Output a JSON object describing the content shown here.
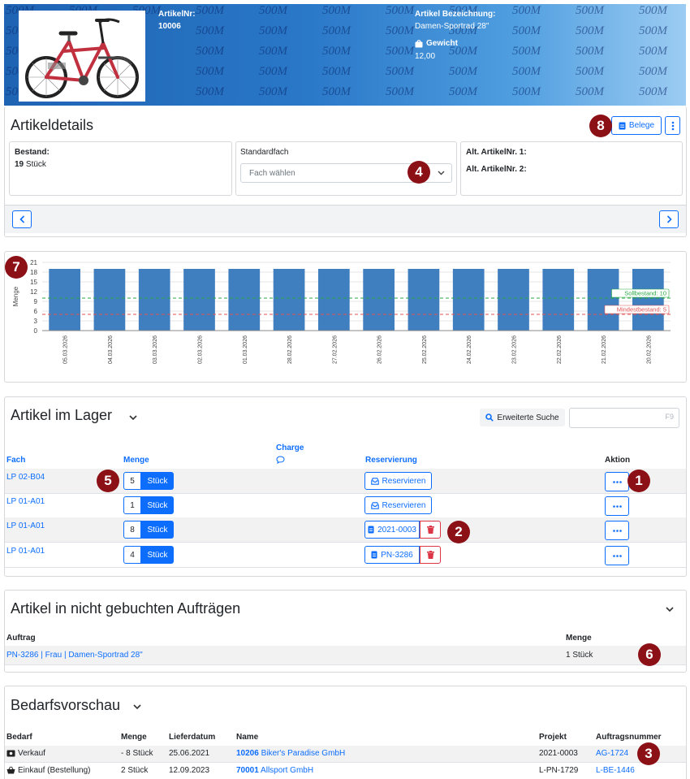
{
  "header": {
    "watermark": "500M",
    "artikelnr_label": "ArtikelNr:",
    "artikelnr_value": "10006",
    "bezeichnung_label": "Artikel Bezeichnung:",
    "bezeichnung_value": "Damen-Sportrad 28\"",
    "gewicht_label": "Gewicht",
    "gewicht_value": "12,00"
  },
  "details": {
    "title": "Artikeldetails",
    "belege_label": "Belege",
    "bestand_label": "Bestand:",
    "bestand_value": "19",
    "bestand_unit": "Stück",
    "standardfach_label": "Standardfach",
    "standardfach_placeholder": "Fach wählen",
    "alt1_label": "Alt. ArtikelNr. 1:",
    "alt2_label": "Alt. ArtikelNr. 2:"
  },
  "chart_data": {
    "type": "bar",
    "ylabel": "Menge",
    "ylim": [
      0,
      21
    ],
    "yticks": [
      0,
      3,
      6,
      9,
      12,
      15,
      18,
      21
    ],
    "categories": [
      "05.03.2026",
      "04.03.2026",
      "03.03.2026",
      "02.03.2026",
      "01.03.2026",
      "28.02.2026",
      "27.02.2026",
      "26.02.2026",
      "25.02.2026",
      "24.02.2026",
      "23.02.2026",
      "22.02.2026",
      "21.02.2026",
      "20.02.2026"
    ],
    "values": [
      19,
      19,
      19,
      19,
      19,
      19,
      19,
      19,
      19,
      19,
      19,
      19,
      19,
      19
    ],
    "bar_color": "#3f7fbf",
    "reference_lines": [
      {
        "label": "Sollbestand: 10",
        "value": 10,
        "color": "#28a745"
      },
      {
        "label": "Mindestbestand: 5",
        "value": 5,
        "color": "#e05252"
      }
    ]
  },
  "lager": {
    "title": "Artikel im Lager",
    "search_button": "Erweiterte Suche",
    "search_shortcut": "F9",
    "columns": {
      "fach": "Fach",
      "menge": "Menge",
      "charge": "Charge",
      "reservierung": "Reservierung",
      "aktion": "Aktion"
    },
    "rows": [
      {
        "fach": "LP 02-B04",
        "menge": "5",
        "unit": "Stück",
        "res": "Reservieren",
        "res_type": "reserve"
      },
      {
        "fach": "LP 01-A01",
        "menge": "1",
        "unit": "Stück",
        "res": "Reservieren",
        "res_type": "reserve"
      },
      {
        "fach": "LP 01-A01",
        "menge": "8",
        "unit": "Stück",
        "res": "2021-0003",
        "res_type": "doc"
      },
      {
        "fach": "LP 01-A01",
        "menge": "4",
        "unit": "Stück",
        "res": "PN-3286",
        "res_type": "doc"
      }
    ]
  },
  "auftraege": {
    "title": "Artikel in nicht gebuchten Aufträgen",
    "col_auftrag": "Auftrag",
    "col_menge": "Menge",
    "rows": [
      {
        "auftrag": "PN-3286 | Frau | Damen-Sportrad 28\"",
        "menge": "1 Stück"
      }
    ]
  },
  "bedarf": {
    "title": "Bedarfsvorschau",
    "columns": {
      "bedarf": "Bedarf",
      "menge": "Menge",
      "lieferdatum": "Lieferdatum",
      "name": "Name",
      "projekt": "Projekt",
      "auftragsnummer": "Auftragsnummer"
    },
    "rows": [
      {
        "bedarf": "Verkauf",
        "menge": "- 8 Stück",
        "lieferdatum": "25.06.2021",
        "name_id": "10206",
        "name": "Biker's Paradise GmbH",
        "projekt": "2021-0003",
        "auftragsnummer": "AG-1724"
      },
      {
        "bedarf": "Einkauf (Bestellung)",
        "menge": "2 Stück",
        "lieferdatum": "12.09.2023",
        "name_id": "70001",
        "name": "Allsport GmbH",
        "projekt": "L-PN-1729",
        "auftragsnummer": "L-BE-1446"
      }
    ]
  },
  "badges": [
    "1",
    "2",
    "3",
    "4",
    "5",
    "6",
    "7",
    "8"
  ]
}
